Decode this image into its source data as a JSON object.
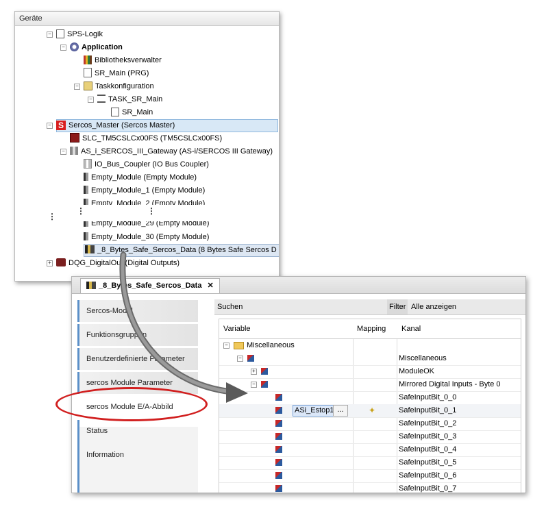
{
  "devices": {
    "title": "Geräte",
    "items": [
      {
        "label": "SPS-Logik",
        "bold": false
      },
      {
        "label": "Application",
        "bold": true
      },
      {
        "label": "Bibliotheksverwalter",
        "bold": false
      },
      {
        "label": "SR_Main (PRG)",
        "bold": false
      },
      {
        "label": "Taskkonfiguration",
        "bold": false
      },
      {
        "label": "TASK_SR_Main",
        "bold": false
      },
      {
        "label": "SR_Main",
        "bold": false
      },
      {
        "label": "Sercos_Master (Sercos Master)",
        "bold": false
      },
      {
        "label": "SLC_TM5CSLCx00FS (TM5CSLCx00FS)",
        "bold": false
      },
      {
        "label": "AS_i_SERCOS_III_Gateway (AS-i/SERCOS III Gateway)",
        "bold": false
      },
      {
        "label": "IO_Bus_Coupler (IO Bus Coupler)",
        "bold": false
      },
      {
        "label": "Empty_Module (Empty Module)",
        "bold": false
      },
      {
        "label": "Empty_Module_1 (Empty Module)",
        "bold": false
      },
      {
        "label": "Empty_Module_2 (Empty Module)",
        "bold": false
      },
      {
        "label": "Empty_Module_29 (Empty Module)",
        "bold": false
      },
      {
        "label": "Empty_Module_30 (Empty Module)",
        "bold": false
      },
      {
        "label": "_8_Bytes_Safe_Sercos_Data (8 Bytes Safe Sercos D",
        "bold": false
      },
      {
        "label": "DQG_DigitalOut (Digital Outputs)",
        "bold": false
      }
    ],
    "sercos_badge": "S",
    "ellipsis": "⋮"
  },
  "editor": {
    "tab_label": "_8_Bytes_Safe_Sercos_Data",
    "close_label": "✕",
    "side_items": [
      "Sercos-Modul",
      "Funktionsgruppen",
      "Benutzerdefinierte Parameter",
      "sercos Module Parameter",
      "sercos Module E/A-Abbild",
      "Status",
      "Information"
    ],
    "active_side_index": 4,
    "search_label": "Suchen",
    "filter_label": "Filter",
    "filter_value": "Alle anzeigen",
    "columns": [
      "Variable",
      "Mapping",
      "Kanal"
    ],
    "folder_label": "Miscellaneous",
    "rows": [
      {
        "variable": "",
        "kanal": "Miscellaneous"
      },
      {
        "variable": "",
        "kanal": "ModuleOK"
      },
      {
        "variable": "",
        "kanal": "Mirrored Digital Inputs - Byte 0"
      },
      {
        "variable": "",
        "kanal": "SafeInputBit_0_0"
      },
      {
        "variable": "ASi_Estop1",
        "kanal": "SafeInputBit_0_1",
        "button": "...",
        "mapped": true
      },
      {
        "variable": "",
        "kanal": "SafeInputBit_0_2"
      },
      {
        "variable": "",
        "kanal": "SafeInputBit_0_3"
      },
      {
        "variable": "",
        "kanal": "SafeInputBit_0_4"
      },
      {
        "variable": "",
        "kanal": "SafeInputBit_0_5"
      },
      {
        "variable": "",
        "kanal": "SafeInputBit_0_6"
      },
      {
        "variable": "",
        "kanal": "SafeInputBit_0_7"
      }
    ]
  },
  "colors": {
    "highlight_ellipse": "#d11f1f",
    "arrow": "#555555",
    "side_accent": "#5a8fc8"
  }
}
